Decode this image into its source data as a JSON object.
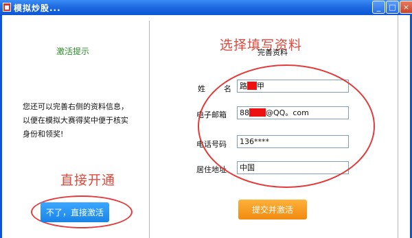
{
  "window": {
    "title": "模拟炒股...",
    "controls": {
      "minimize": "_",
      "maximize": "□",
      "close": "×"
    }
  },
  "left_panel": {
    "heading": "激活提示",
    "description": "您还可以完善右侧的资料信息，以便在模拟大赛得奖中便于核实身份和领奖!",
    "annotation": "直接开通",
    "skip_button": "不了，直接激活"
  },
  "right_panel": {
    "annotation": "选择填写资料",
    "form_title": "完善资料",
    "fields": {
      "name": {
        "label_1": "姓",
        "label_2": "名",
        "value_prefix": "路",
        "value_suffix": "甲"
      },
      "email": {
        "label": "电子邮箱",
        "value_prefix": "88",
        "value_suffix": "@QQ。com"
      },
      "phone": {
        "label": "电话号码",
        "value": "136****"
      },
      "address": {
        "label": "居住地址",
        "value": "中国"
      }
    },
    "submit_button": "提交并激活"
  },
  "colors": {
    "titlebar": "#1f6be0",
    "annotation_red": "#e2483c",
    "heading_green": "#2a8a2a",
    "skip_button_blue": "#1a84e6",
    "submit_button_orange": "#f08a10",
    "redaction": "#ee1111"
  },
  "icons": {
    "app": "app-icon"
  }
}
